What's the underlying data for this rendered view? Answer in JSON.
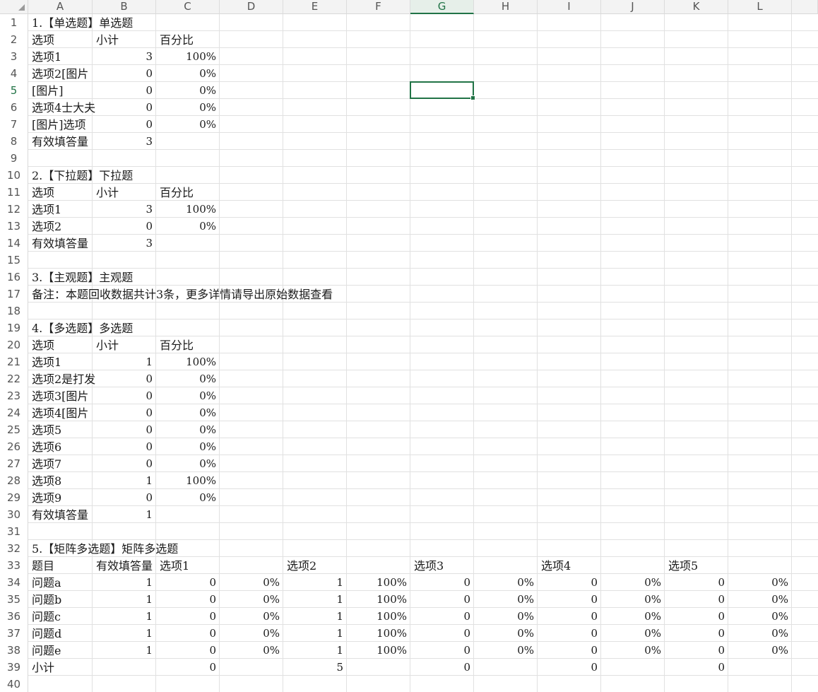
{
  "columns": [
    "A",
    "B",
    "C",
    "D",
    "E",
    "F",
    "G",
    "H",
    "I",
    "J",
    "K",
    "L"
  ],
  "active_column": "G",
  "active_row": 5,
  "row_count": 40,
  "cells": [
    {
      "r": 1,
      "c": 0,
      "v": "1.【单选题】单选题",
      "t": "s"
    },
    {
      "r": 2,
      "c": 0,
      "v": "选项",
      "t": "s"
    },
    {
      "r": 2,
      "c": 1,
      "v": "小计",
      "t": "s"
    },
    {
      "r": 2,
      "c": 2,
      "v": "百分比",
      "t": "s"
    },
    {
      "r": 3,
      "c": 0,
      "v": "选项1",
      "t": "s"
    },
    {
      "r": 3,
      "c": 1,
      "v": "3",
      "t": "n"
    },
    {
      "r": 3,
      "c": 2,
      "v": "100%",
      "t": "n"
    },
    {
      "r": 4,
      "c": 0,
      "v": "选项2[图片",
      "t": "s",
      "clip": true
    },
    {
      "r": 4,
      "c": 1,
      "v": "0",
      "t": "n"
    },
    {
      "r": 4,
      "c": 2,
      "v": "0%",
      "t": "n"
    },
    {
      "r": 5,
      "c": 0,
      "v": "[图片]",
      "t": "s"
    },
    {
      "r": 5,
      "c": 1,
      "v": "0",
      "t": "n"
    },
    {
      "r": 5,
      "c": 2,
      "v": "0%",
      "t": "n"
    },
    {
      "r": 6,
      "c": 0,
      "v": "选项4士大夫",
      "t": "s",
      "clip": true
    },
    {
      "r": 6,
      "c": 1,
      "v": "0",
      "t": "n"
    },
    {
      "r": 6,
      "c": 2,
      "v": "0%",
      "t": "n"
    },
    {
      "r": 7,
      "c": 0,
      "v": "[图片]选项",
      "t": "s",
      "clip": true
    },
    {
      "r": 7,
      "c": 1,
      "v": "0",
      "t": "n"
    },
    {
      "r": 7,
      "c": 2,
      "v": "0%",
      "t": "n"
    },
    {
      "r": 8,
      "c": 0,
      "v": "有效填答量",
      "t": "s",
      "clip": true
    },
    {
      "r": 8,
      "c": 1,
      "v": "3",
      "t": "n"
    },
    {
      "r": 10,
      "c": 0,
      "v": "2.【下拉题】下拉题",
      "t": "s"
    },
    {
      "r": 11,
      "c": 0,
      "v": "选项",
      "t": "s"
    },
    {
      "r": 11,
      "c": 1,
      "v": "小计",
      "t": "s"
    },
    {
      "r": 11,
      "c": 2,
      "v": "百分比",
      "t": "s"
    },
    {
      "r": 12,
      "c": 0,
      "v": "选项1",
      "t": "s"
    },
    {
      "r": 12,
      "c": 1,
      "v": "3",
      "t": "n"
    },
    {
      "r": 12,
      "c": 2,
      "v": "100%",
      "t": "n"
    },
    {
      "r": 13,
      "c": 0,
      "v": "选项2",
      "t": "s"
    },
    {
      "r": 13,
      "c": 1,
      "v": "0",
      "t": "n"
    },
    {
      "r": 13,
      "c": 2,
      "v": "0%",
      "t": "n"
    },
    {
      "r": 14,
      "c": 0,
      "v": "有效填答量",
      "t": "s",
      "clip": true
    },
    {
      "r": 14,
      "c": 1,
      "v": "3",
      "t": "n"
    },
    {
      "r": 16,
      "c": 0,
      "v": "3.【主观题】主观题",
      "t": "s"
    },
    {
      "r": 17,
      "c": 0,
      "v": "备注：本题回收数据共计3条，更多详情请导出原始数据查看",
      "t": "s"
    },
    {
      "r": 19,
      "c": 0,
      "v": "4.【多选题】多选题",
      "t": "s"
    },
    {
      "r": 20,
      "c": 0,
      "v": "选项",
      "t": "s"
    },
    {
      "r": 20,
      "c": 1,
      "v": "小计",
      "t": "s"
    },
    {
      "r": 20,
      "c": 2,
      "v": "百分比",
      "t": "s"
    },
    {
      "r": 21,
      "c": 0,
      "v": "选项1",
      "t": "s"
    },
    {
      "r": 21,
      "c": 1,
      "v": "1",
      "t": "n"
    },
    {
      "r": 21,
      "c": 2,
      "v": "100%",
      "t": "n"
    },
    {
      "r": 22,
      "c": 0,
      "v": "选项2是打发",
      "t": "s",
      "clip": true
    },
    {
      "r": 22,
      "c": 1,
      "v": "0",
      "t": "n"
    },
    {
      "r": 22,
      "c": 2,
      "v": "0%",
      "t": "n"
    },
    {
      "r": 23,
      "c": 0,
      "v": "选项3[图片",
      "t": "s",
      "clip": true
    },
    {
      "r": 23,
      "c": 1,
      "v": "0",
      "t": "n"
    },
    {
      "r": 23,
      "c": 2,
      "v": "0%",
      "t": "n"
    },
    {
      "r": 24,
      "c": 0,
      "v": "选项4[图片",
      "t": "s",
      "clip": true
    },
    {
      "r": 24,
      "c": 1,
      "v": "0",
      "t": "n"
    },
    {
      "r": 24,
      "c": 2,
      "v": "0%",
      "t": "n"
    },
    {
      "r": 25,
      "c": 0,
      "v": "选项5",
      "t": "s"
    },
    {
      "r": 25,
      "c": 1,
      "v": "0",
      "t": "n"
    },
    {
      "r": 25,
      "c": 2,
      "v": "0%",
      "t": "n"
    },
    {
      "r": 26,
      "c": 0,
      "v": "选项6",
      "t": "s"
    },
    {
      "r": 26,
      "c": 1,
      "v": "0",
      "t": "n"
    },
    {
      "r": 26,
      "c": 2,
      "v": "0%",
      "t": "n"
    },
    {
      "r": 27,
      "c": 0,
      "v": "选项7",
      "t": "s"
    },
    {
      "r": 27,
      "c": 1,
      "v": "0",
      "t": "n"
    },
    {
      "r": 27,
      "c": 2,
      "v": "0%",
      "t": "n"
    },
    {
      "r": 28,
      "c": 0,
      "v": "选项8",
      "t": "s"
    },
    {
      "r": 28,
      "c": 1,
      "v": "1",
      "t": "n"
    },
    {
      "r": 28,
      "c": 2,
      "v": "100%",
      "t": "n"
    },
    {
      "r": 29,
      "c": 0,
      "v": "选项9",
      "t": "s"
    },
    {
      "r": 29,
      "c": 1,
      "v": "0",
      "t": "n"
    },
    {
      "r": 29,
      "c": 2,
      "v": "0%",
      "t": "n"
    },
    {
      "r": 30,
      "c": 0,
      "v": "有效填答量",
      "t": "s",
      "clip": true
    },
    {
      "r": 30,
      "c": 1,
      "v": "1",
      "t": "n"
    },
    {
      "r": 32,
      "c": 0,
      "v": "5.【矩阵多选题】矩阵多选题",
      "t": "s"
    },
    {
      "r": 33,
      "c": 0,
      "v": "题目",
      "t": "s"
    },
    {
      "r": 33,
      "c": 1,
      "v": "有效填答量",
      "t": "s",
      "clip": true
    },
    {
      "r": 33,
      "c": 2,
      "v": "选项1",
      "t": "s"
    },
    {
      "r": 33,
      "c": 4,
      "v": "选项2",
      "t": "s"
    },
    {
      "r": 33,
      "c": 6,
      "v": "选项3",
      "t": "s"
    },
    {
      "r": 33,
      "c": 8,
      "v": "选项4",
      "t": "s"
    },
    {
      "r": 33,
      "c": 10,
      "v": "选项5",
      "t": "s"
    },
    {
      "r": 34,
      "c": 0,
      "v": "问题a",
      "t": "s"
    },
    {
      "r": 34,
      "c": 1,
      "v": "1",
      "t": "n"
    },
    {
      "r": 34,
      "c": 2,
      "v": "0",
      "t": "n"
    },
    {
      "r": 34,
      "c": 3,
      "v": "0%",
      "t": "n"
    },
    {
      "r": 34,
      "c": 4,
      "v": "1",
      "t": "n"
    },
    {
      "r": 34,
      "c": 5,
      "v": "100%",
      "t": "n"
    },
    {
      "r": 34,
      "c": 6,
      "v": "0",
      "t": "n"
    },
    {
      "r": 34,
      "c": 7,
      "v": "0%",
      "t": "n"
    },
    {
      "r": 34,
      "c": 8,
      "v": "0",
      "t": "n"
    },
    {
      "r": 34,
      "c": 9,
      "v": "0%",
      "t": "n"
    },
    {
      "r": 34,
      "c": 10,
      "v": "0",
      "t": "n"
    },
    {
      "r": 34,
      "c": 11,
      "v": "0%",
      "t": "n"
    },
    {
      "r": 35,
      "c": 0,
      "v": "问题b",
      "t": "s"
    },
    {
      "r": 35,
      "c": 1,
      "v": "1",
      "t": "n"
    },
    {
      "r": 35,
      "c": 2,
      "v": "0",
      "t": "n"
    },
    {
      "r": 35,
      "c": 3,
      "v": "0%",
      "t": "n"
    },
    {
      "r": 35,
      "c": 4,
      "v": "1",
      "t": "n"
    },
    {
      "r": 35,
      "c": 5,
      "v": "100%",
      "t": "n"
    },
    {
      "r": 35,
      "c": 6,
      "v": "0",
      "t": "n"
    },
    {
      "r": 35,
      "c": 7,
      "v": "0%",
      "t": "n"
    },
    {
      "r": 35,
      "c": 8,
      "v": "0",
      "t": "n"
    },
    {
      "r": 35,
      "c": 9,
      "v": "0%",
      "t": "n"
    },
    {
      "r": 35,
      "c": 10,
      "v": "0",
      "t": "n"
    },
    {
      "r": 35,
      "c": 11,
      "v": "0%",
      "t": "n"
    },
    {
      "r": 36,
      "c": 0,
      "v": "问题c",
      "t": "s"
    },
    {
      "r": 36,
      "c": 1,
      "v": "1",
      "t": "n"
    },
    {
      "r": 36,
      "c": 2,
      "v": "0",
      "t": "n"
    },
    {
      "r": 36,
      "c": 3,
      "v": "0%",
      "t": "n"
    },
    {
      "r": 36,
      "c": 4,
      "v": "1",
      "t": "n"
    },
    {
      "r": 36,
      "c": 5,
      "v": "100%",
      "t": "n"
    },
    {
      "r": 36,
      "c": 6,
      "v": "0",
      "t": "n"
    },
    {
      "r": 36,
      "c": 7,
      "v": "0%",
      "t": "n"
    },
    {
      "r": 36,
      "c": 8,
      "v": "0",
      "t": "n"
    },
    {
      "r": 36,
      "c": 9,
      "v": "0%",
      "t": "n"
    },
    {
      "r": 36,
      "c": 10,
      "v": "0",
      "t": "n"
    },
    {
      "r": 36,
      "c": 11,
      "v": "0%",
      "t": "n"
    },
    {
      "r": 37,
      "c": 0,
      "v": "问题d",
      "t": "s"
    },
    {
      "r": 37,
      "c": 1,
      "v": "1",
      "t": "n"
    },
    {
      "r": 37,
      "c": 2,
      "v": "0",
      "t": "n"
    },
    {
      "r": 37,
      "c": 3,
      "v": "0%",
      "t": "n"
    },
    {
      "r": 37,
      "c": 4,
      "v": "1",
      "t": "n"
    },
    {
      "r": 37,
      "c": 5,
      "v": "100%",
      "t": "n"
    },
    {
      "r": 37,
      "c": 6,
      "v": "0",
      "t": "n"
    },
    {
      "r": 37,
      "c": 7,
      "v": "0%",
      "t": "n"
    },
    {
      "r": 37,
      "c": 8,
      "v": "0",
      "t": "n"
    },
    {
      "r": 37,
      "c": 9,
      "v": "0%",
      "t": "n"
    },
    {
      "r": 37,
      "c": 10,
      "v": "0",
      "t": "n"
    },
    {
      "r": 37,
      "c": 11,
      "v": "0%",
      "t": "n"
    },
    {
      "r": 38,
      "c": 0,
      "v": "问题e",
      "t": "s"
    },
    {
      "r": 38,
      "c": 1,
      "v": "1",
      "t": "n"
    },
    {
      "r": 38,
      "c": 2,
      "v": "0",
      "t": "n"
    },
    {
      "r": 38,
      "c": 3,
      "v": "0%",
      "t": "n"
    },
    {
      "r": 38,
      "c": 4,
      "v": "1",
      "t": "n"
    },
    {
      "r": 38,
      "c": 5,
      "v": "100%",
      "t": "n"
    },
    {
      "r": 38,
      "c": 6,
      "v": "0",
      "t": "n"
    },
    {
      "r": 38,
      "c": 7,
      "v": "0%",
      "t": "n"
    },
    {
      "r": 38,
      "c": 8,
      "v": "0",
      "t": "n"
    },
    {
      "r": 38,
      "c": 9,
      "v": "0%",
      "t": "n"
    },
    {
      "r": 38,
      "c": 10,
      "v": "0",
      "t": "n"
    },
    {
      "r": 38,
      "c": 11,
      "v": "0%",
      "t": "n"
    },
    {
      "r": 39,
      "c": 0,
      "v": "小计",
      "t": "s"
    },
    {
      "r": 39,
      "c": 2,
      "v": "0",
      "t": "n"
    },
    {
      "r": 39,
      "c": 4,
      "v": "5",
      "t": "n"
    },
    {
      "r": 39,
      "c": 6,
      "v": "0",
      "t": "n"
    },
    {
      "r": 39,
      "c": 8,
      "v": "0",
      "t": "n"
    },
    {
      "r": 39,
      "c": 10,
      "v": "0",
      "t": "n"
    }
  ],
  "colors": {
    "accent": "#217346",
    "gridline": "#e1e1e1",
    "header_bg": "#f3f3f3"
  }
}
